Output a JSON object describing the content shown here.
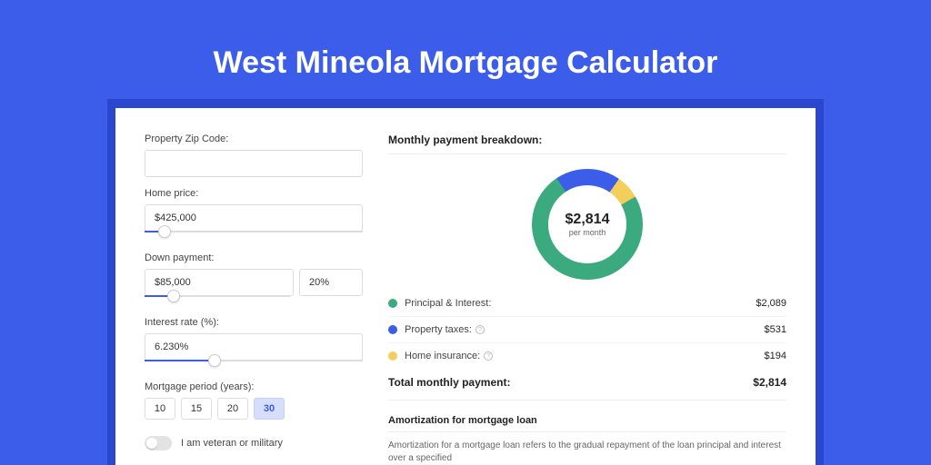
{
  "title": "West Mineola Mortgage Calculator",
  "colors": {
    "principal": "#3BAA7F",
    "taxes": "#3C5CEA",
    "insurance": "#F4CE5B"
  },
  "form": {
    "zip_label": "Property Zip Code:",
    "zip_value": "",
    "price_label": "Home price:",
    "price_value": "$425,000",
    "price_slider_pct": 9,
    "down_label": "Down payment:",
    "down_amount": "$85,000",
    "down_pct": "20%",
    "down_slider_pct": 20,
    "rate_label": "Interest rate (%):",
    "rate_value": "6.230%",
    "rate_slider_pct": 32,
    "period_label": "Mortgage period (years):",
    "periods": [
      "10",
      "15",
      "20",
      "30"
    ],
    "period_selected": "30",
    "veteran_label": "I am veteran or military"
  },
  "breakdown": {
    "title": "Monthly payment breakdown:",
    "amount": "$2,814",
    "sub": "per month",
    "items": [
      {
        "key": "principal",
        "label": "Principal & Interest:",
        "value": "$2,089",
        "pct": 74,
        "info": false
      },
      {
        "key": "taxes",
        "label": "Property taxes:",
        "value": "$531",
        "pct": 19,
        "info": true
      },
      {
        "key": "insurance",
        "label": "Home insurance:",
        "value": "$194",
        "pct": 7,
        "info": true
      }
    ],
    "total_label": "Total monthly payment:",
    "total_value": "$2,814"
  },
  "amort": {
    "title": "Amortization for mortgage loan",
    "text": "Amortization for a mortgage loan refers to the gradual repayment of the loan principal and interest over a specified"
  },
  "chart_data": {
    "type": "pie",
    "title": "Monthly payment breakdown",
    "categories": [
      "Principal & Interest",
      "Property taxes",
      "Home insurance"
    ],
    "values": [
      2089,
      531,
      194
    ],
    "total": 2814,
    "colors": [
      "#3BAA7F",
      "#3C5CEA",
      "#F4CE5B"
    ]
  }
}
